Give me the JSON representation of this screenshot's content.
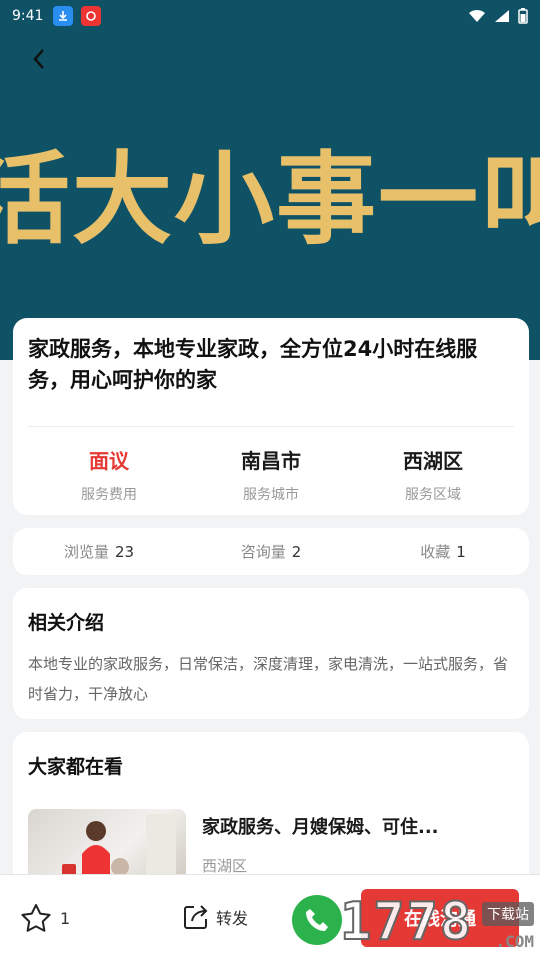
{
  "status_bar": {
    "time": "9:41"
  },
  "hero": {
    "banner_text": "活大小事一叫就"
  },
  "title_card": {
    "title": "家政服务，本地专业家政，全方位24小时在线服务，用心呵护你的家",
    "stats": [
      {
        "value": "面议",
        "label": "服务费用"
      },
      {
        "value": "南昌市",
        "label": "服务城市"
      },
      {
        "value": "西湖区",
        "label": "服务区域"
      }
    ]
  },
  "counts": [
    {
      "label": "浏览量",
      "value": "23"
    },
    {
      "label": "咨询量",
      "value": "2"
    },
    {
      "label": "收藏",
      "value": "1"
    }
  ],
  "intro": {
    "title": "相关介绍",
    "text": "本地专业的家政服务，日常保洁，深度清理，家电清洗，一站式服务，省时省力，干净放心"
  },
  "related": {
    "title": "大家都在看",
    "items": [
      {
        "title": "家政服务、月嫂保姆、可住...",
        "area": "西湖区"
      }
    ]
  },
  "bottom_bar": {
    "fav_count": "1",
    "share_label": "转发",
    "chat_label": "在线沟通"
  },
  "watermark": {
    "digits": "1778",
    "label": "下载站",
    "suffix": ".COM"
  },
  "colors": {
    "hero_bg": "#0f5266",
    "banner_text": "#e8c06a",
    "accent_red": "#e53935",
    "phone_green": "#2bb24c"
  }
}
